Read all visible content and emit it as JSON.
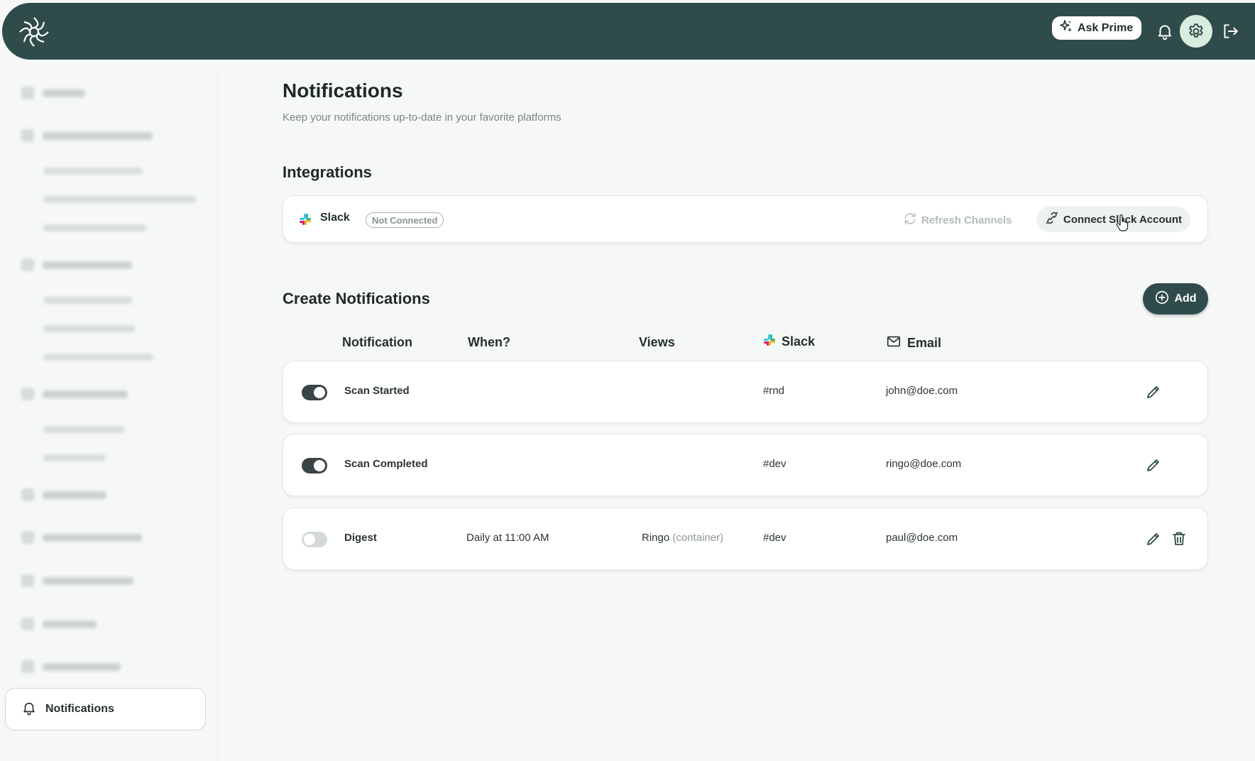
{
  "header": {
    "ask_label": "Ask Prime"
  },
  "sidebar": {
    "active_item": "Notifications"
  },
  "page": {
    "title": "Notifications",
    "subtitle": "Keep your notifications up-to-date in your favorite platforms"
  },
  "integrations": {
    "title": "Integrations",
    "slack": {
      "name": "Slack",
      "status": "Not Connected",
      "refresh_label": "Refresh Channels",
      "connect_label": "Connect Slack Account"
    }
  },
  "notifications": {
    "title": "Create Notifications",
    "add_label": "Add",
    "columns": {
      "notification": "Notification",
      "when": "When?",
      "views": "Views",
      "slack": "Slack",
      "email": "Email"
    },
    "rows": [
      {
        "enabled": true,
        "name": "Scan Started",
        "when": "",
        "view": "",
        "view_note": "",
        "slack": "#rnd",
        "email": "john@doe.com",
        "deletable": false
      },
      {
        "enabled": true,
        "name": "Scan Completed",
        "when": "",
        "view": "",
        "view_note": "",
        "slack": "#dev",
        "email": "ringo@doe.com",
        "deletable": false
      },
      {
        "enabled": false,
        "name": "Digest",
        "when": "Daily at 11:00 AM",
        "view": "Ringo",
        "view_note": "(container)",
        "slack": "#dev",
        "email": "paul@doe.com",
        "deletable": true
      }
    ]
  },
  "colors": {
    "brand": "#304c4a",
    "gear_bg": "#d8ecdf",
    "toggle_on": "#3a4645",
    "toggle_off": "#d4d9d9"
  },
  "icons": [
    "logo-icon",
    "sparkle-icon",
    "bell-icon",
    "gear-icon",
    "logout-icon",
    "slack-icon",
    "refresh-icon",
    "link-icon",
    "plus-circle-icon",
    "mail-icon",
    "pencil-icon",
    "trash-icon"
  ]
}
